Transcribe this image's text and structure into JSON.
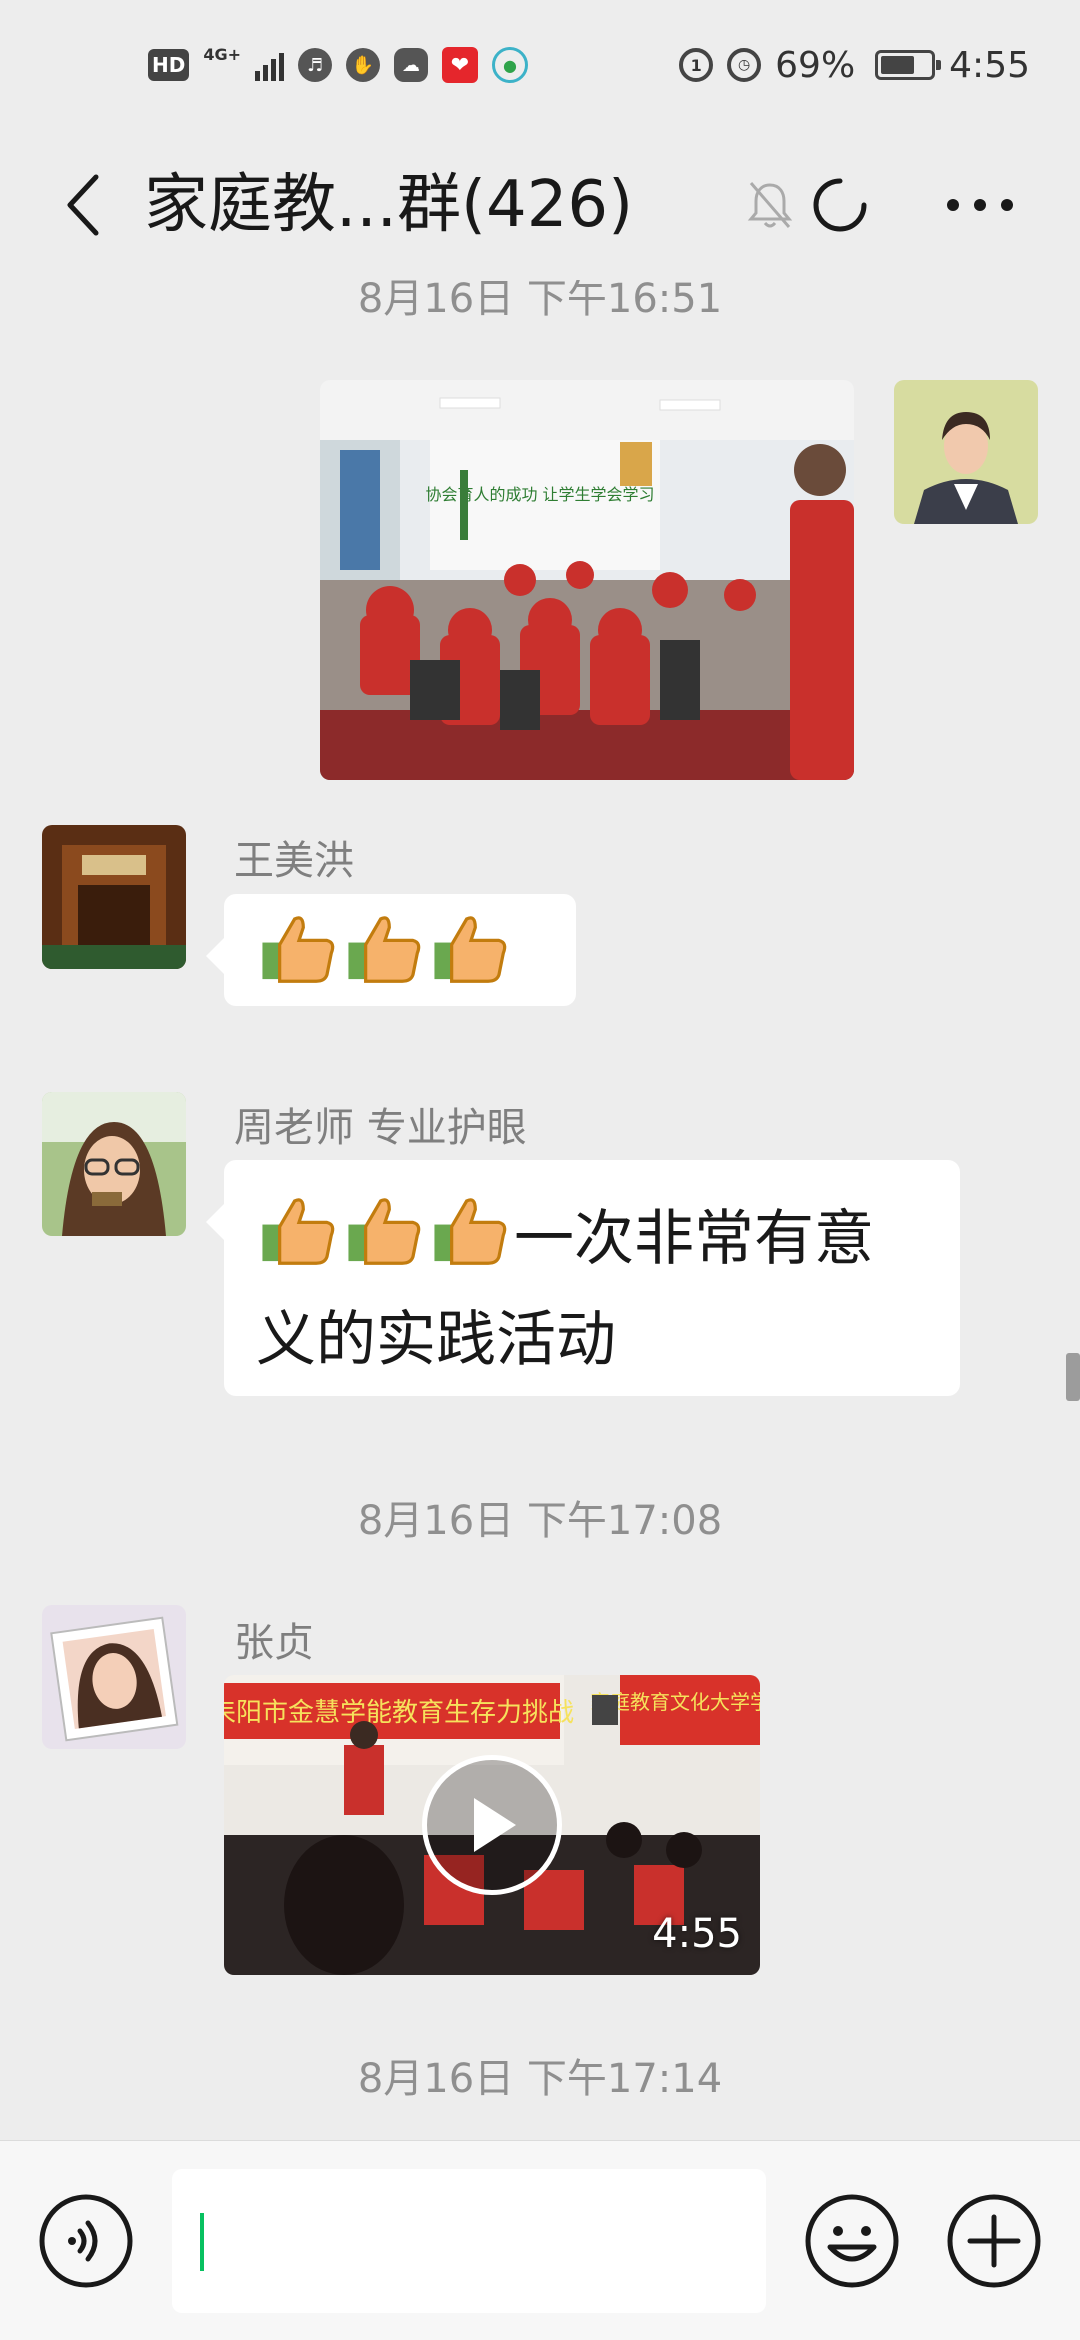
{
  "status_bar": {
    "hd": "HD",
    "network": "4G+",
    "battery_percent": "69%",
    "battery_level": 0.69,
    "time": "4:55"
  },
  "header": {
    "title": "家庭教...群(426)"
  },
  "messages": {
    "ts1": "8月16日 下午16:51",
    "msg2": {
      "sender": "王美洪"
    },
    "msg3": {
      "sender": "周老师 专业护眼",
      "text": "一次非常有意义的实践活动"
    },
    "ts2": "8月16日 下午17:08",
    "msg4": {
      "sender": "张贞",
      "video_duration": "4:55",
      "banner_left": "耒阳市金慧学能教育生存力挑战",
      "banner_right": "家庭教育文化大学学院"
    },
    "ts3": "8月16日 下午17:14"
  },
  "photo_banner": "协会育人的成功 让学生学会学习",
  "colors": {
    "background": "#ededed",
    "bubble": "#ffffff",
    "accent": "#07c160",
    "banner_red": "#d8322a"
  },
  "icons": {
    "back": "chevron-left-icon",
    "mute": "bell-off-icon",
    "refresh": "refresh-icon",
    "more": "more-icon",
    "voice": "voice-icon",
    "emoji": "emoji-icon",
    "plus": "plus-icon"
  }
}
